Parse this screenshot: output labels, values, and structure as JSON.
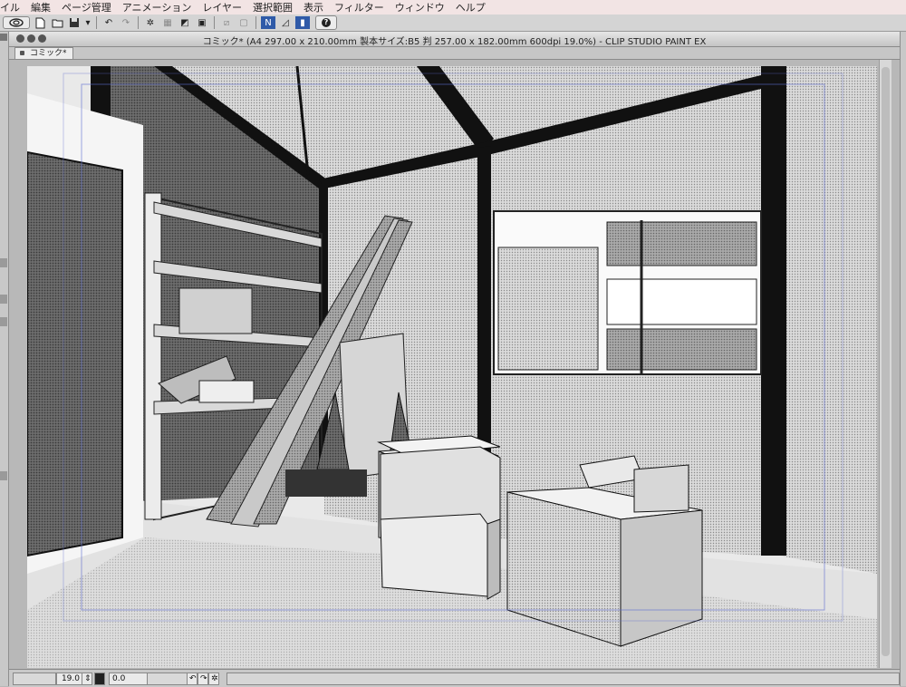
{
  "menubar": {
    "items": [
      "イル",
      "編集",
      "ページ管理",
      "アニメーション",
      "レイヤー",
      "選択範囲",
      "表示",
      "フィルター",
      "ウィンドウ",
      "ヘルプ"
    ]
  },
  "toolbar": {
    "help_label": "?"
  },
  "window": {
    "title": "コミック* (A4 297.00 x 210.00mm 製本サイズ:B5 判 257.00 x 182.00mm 600dpi 19.0%)  - CLIP STUDIO PAINT EX"
  },
  "tabs": [
    {
      "label": "コミック*"
    }
  ],
  "status": {
    "zoom": "19.0",
    "angle": "0.0"
  },
  "colors": {
    "menubar_bg": "#f2e4e4",
    "chrome": "#d4d4d4",
    "canvas_bg": "#e9e9e9"
  }
}
